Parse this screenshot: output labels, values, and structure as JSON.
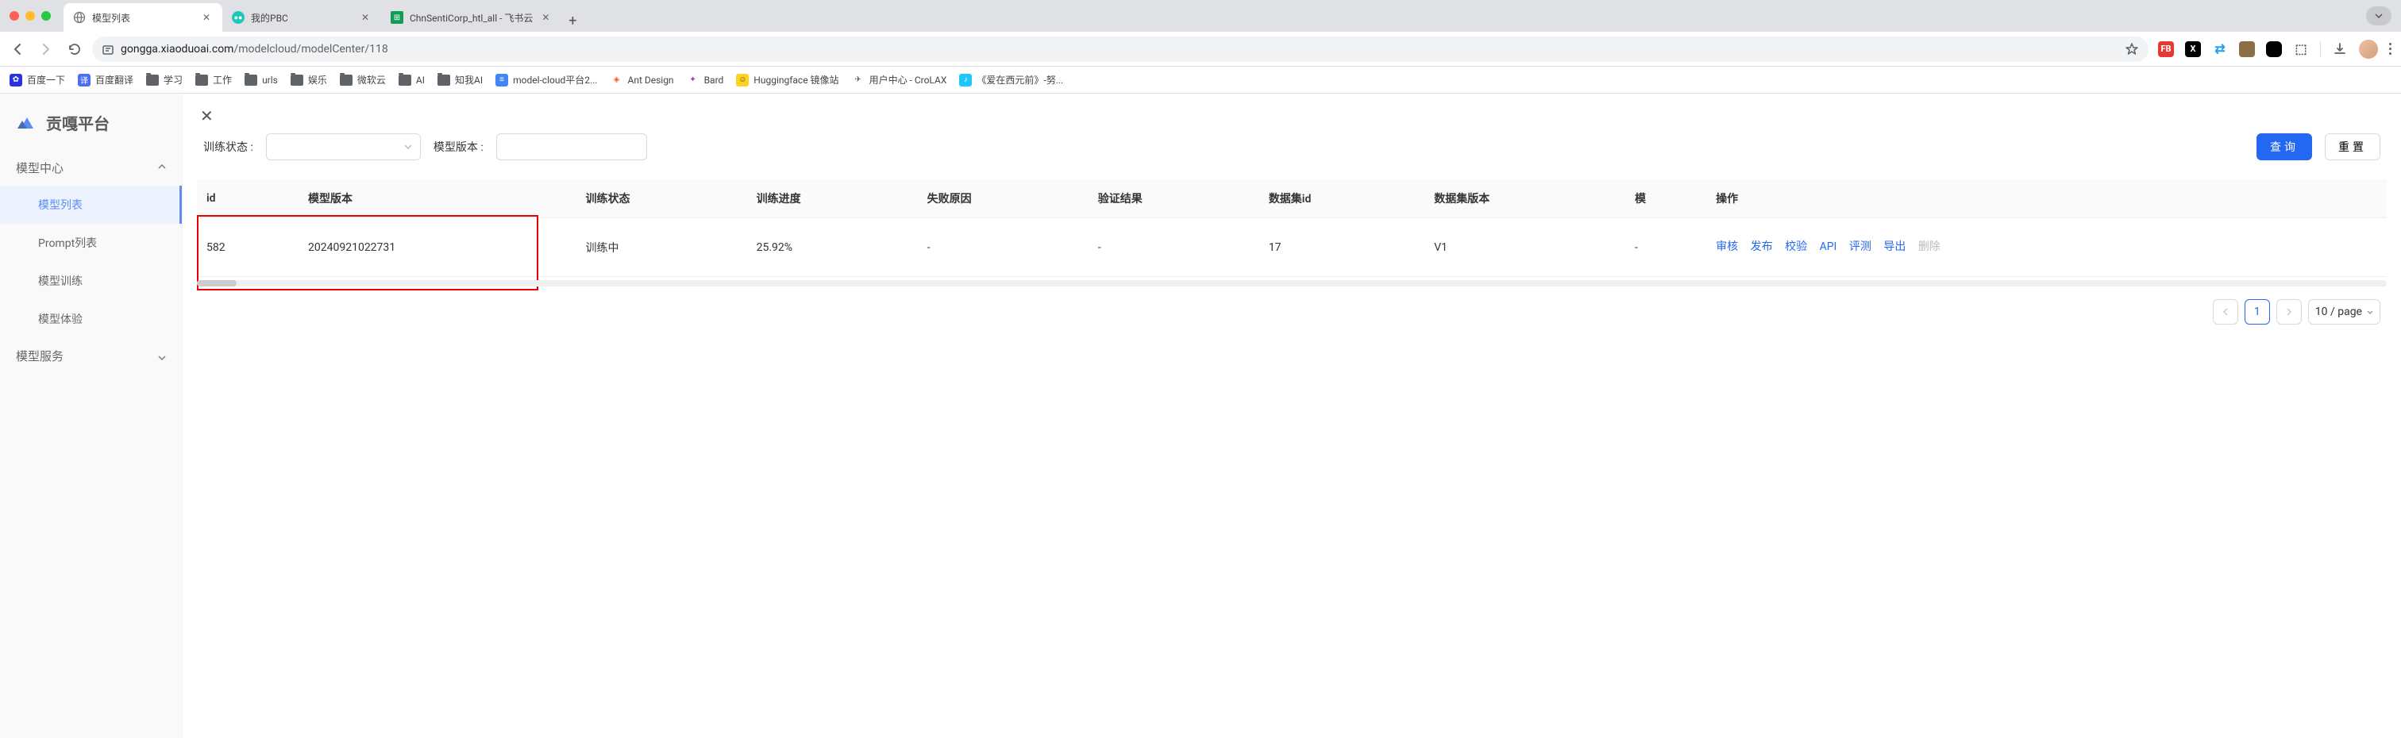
{
  "browser": {
    "tabs": [
      {
        "title": "模型列表",
        "active": true
      },
      {
        "title": "我的PBC",
        "active": false
      },
      {
        "title": "ChnSentiCorp_htl_all - 飞书云",
        "active": false
      }
    ],
    "url_prefix": "gongga.xiaoduoai.com",
    "url_path": "/modelcloud/modelCenter/118"
  },
  "bookmarks": [
    {
      "label": "百度一下",
      "icon_bg": "#2932e1",
      "icon_color": "#fff",
      "glyph": "✿"
    },
    {
      "label": "百度翻译",
      "icon_bg": "#4e6ef2",
      "icon_color": "#fff",
      "glyph": "译"
    },
    {
      "label": "学习",
      "type": "folder"
    },
    {
      "label": "工作",
      "type": "folder"
    },
    {
      "label": "urls",
      "type": "folder"
    },
    {
      "label": "娱乐",
      "type": "folder"
    },
    {
      "label": "微软云",
      "type": "folder"
    },
    {
      "label": "AI",
      "type": "folder"
    },
    {
      "label": "知我AI",
      "type": "folder"
    },
    {
      "label": "model-cloud平台2...",
      "icon_bg": "#4285f4",
      "icon_color": "#fff",
      "glyph": "≡"
    },
    {
      "label": "Ant Design",
      "icon_bg": "#fff",
      "icon_color": "#f5222d",
      "glyph": "◈"
    },
    {
      "label": "Bard",
      "icon_bg": "#fff",
      "icon_color": "#8e44ad",
      "glyph": "✦"
    },
    {
      "label": "Huggingface 镜像站",
      "icon_bg": "#ffd21e",
      "icon_color": "#000",
      "glyph": "☺"
    },
    {
      "label": "用户中心 - CroLAX",
      "icon_bg": "#fff",
      "icon_color": "#555",
      "glyph": "✈"
    },
    {
      "label": "《爱在西元前》-努...",
      "icon_bg": "#1ec8ff",
      "icon_color": "#fff",
      "glyph": "♪"
    }
  ],
  "sidebar": {
    "logo": "贡嘎平台",
    "groups": [
      {
        "label": "模型中心",
        "expanded": true,
        "items": [
          {
            "label": "模型列表",
            "active": true
          },
          {
            "label": "Prompt列表",
            "active": false
          },
          {
            "label": "模型训练",
            "active": false
          },
          {
            "label": "模型体验",
            "active": false
          }
        ]
      },
      {
        "label": "模型服务",
        "expanded": false,
        "items": []
      }
    ]
  },
  "filters": {
    "status_label": "训练状态 :",
    "version_label": "模型版本 :",
    "query_btn": "查询",
    "reset_btn": "重置"
  },
  "table": {
    "headers": [
      "id",
      "模型版本",
      "训练状态",
      "训练进度",
      "失败原因",
      "验证结果",
      "数据集id",
      "数据集版本",
      "模",
      "操作"
    ],
    "rows": [
      {
        "id": "582",
        "version": "20240921022731",
        "status": "训练中",
        "progress": "25.92%",
        "fail": "-",
        "verify": "-",
        "dataset_id": "17",
        "dataset_ver": "V1",
        "trunc": "-",
        "actions": [
          {
            "label": "审核",
            "disabled": false
          },
          {
            "label": "发布",
            "disabled": false
          },
          {
            "label": "校验",
            "disabled": false
          },
          {
            "label": "API",
            "disabled": false
          },
          {
            "label": "评测",
            "disabled": false
          },
          {
            "label": "导出",
            "disabled": false
          },
          {
            "label": "删除",
            "disabled": true
          }
        ]
      }
    ]
  },
  "pagination": {
    "current": "1",
    "page_size": "10 / page"
  }
}
